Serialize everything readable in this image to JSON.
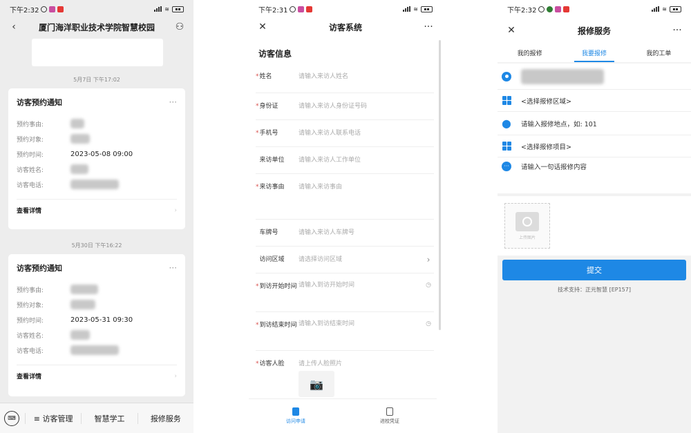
{
  "panel1": {
    "status_time": "下午2:32",
    "title": "厦门海洋职业技术学院智慧校园",
    "messages": [
      {
        "timestamp": "5月7日 下午17:02",
        "card_title": "访客预约通知",
        "fields": [
          {
            "key": "预约事由:",
            "value": ""
          },
          {
            "key": "预约对象:",
            "value": ""
          },
          {
            "key": "预约时间:",
            "value": "2023-05-08 09:00"
          },
          {
            "key": "访客姓名:",
            "value": ""
          },
          {
            "key": "访客电话:",
            "value": ""
          }
        ],
        "link": "查看详情"
      },
      {
        "timestamp": "5月30日 下午16:22",
        "card_title": "访客预约通知",
        "fields": [
          {
            "key": "预约事由:",
            "value": ""
          },
          {
            "key": "预约对象:",
            "value": ""
          },
          {
            "key": "预约时间:",
            "value": "2023-05-31 09:30"
          },
          {
            "key": "访客姓名:",
            "value": ""
          },
          {
            "key": "访客电话:",
            "value": ""
          }
        ],
        "link": "查看详情"
      }
    ],
    "bottom_menu": [
      "≡ 访客管理",
      "智慧学工",
      "报修服务"
    ]
  },
  "panel2": {
    "status_time": "下午2:31",
    "title": "访客系统",
    "section_title": "访客信息",
    "fields": [
      {
        "label": "姓名",
        "required": true,
        "placeholder": "请输入来访人姓名"
      },
      {
        "label": "身份证",
        "required": true,
        "placeholder": "请输入来访人身份证号码"
      },
      {
        "label": "手机号",
        "required": true,
        "placeholder": "请输入来访人联系电话"
      },
      {
        "label": "来访单位",
        "required": false,
        "placeholder": "请输入来访人工作单位"
      },
      {
        "label": "来访事由",
        "required": true,
        "placeholder": "请输入来访事由"
      },
      {
        "label": "车牌号",
        "required": false,
        "placeholder": "请输入来访人车牌号"
      },
      {
        "label": "访问区域",
        "required": false,
        "placeholder": "请选择访问区域"
      },
      {
        "label": "到访开始时间",
        "required": true,
        "placeholder": "请输入到访开始时间"
      },
      {
        "label": "到访结束时间",
        "required": true,
        "placeholder": "请输入到访结束时间"
      },
      {
        "label": "访客人脸",
        "required": true,
        "placeholder": "请上传人脸照片"
      }
    ],
    "tabs": [
      "访问申请",
      "进校凭证"
    ]
  },
  "panel3": {
    "status_time": "下午2:32",
    "title": "报修服务",
    "tabs": [
      "我的报修",
      "我要报修",
      "我的工单"
    ],
    "rows": [
      {
        "icon": "user-icon",
        "text": ""
      },
      {
        "icon": "grid-icon",
        "text": "<选择报修区域>"
      },
      {
        "icon": "location-pin-icon",
        "text": "请输入报修地点，如: 101"
      },
      {
        "icon": "grid-icon",
        "text": "<选择报修项目>"
      },
      {
        "icon": "chat-icon",
        "text": "请输入一句话报修内容"
      }
    ],
    "upload_label": "上传图片",
    "submit_label": "提交",
    "support_text": "技术支持：正元智慧 [EP157]"
  },
  "colors": {
    "accent": "#1e88e5",
    "required": "#d9534f"
  }
}
